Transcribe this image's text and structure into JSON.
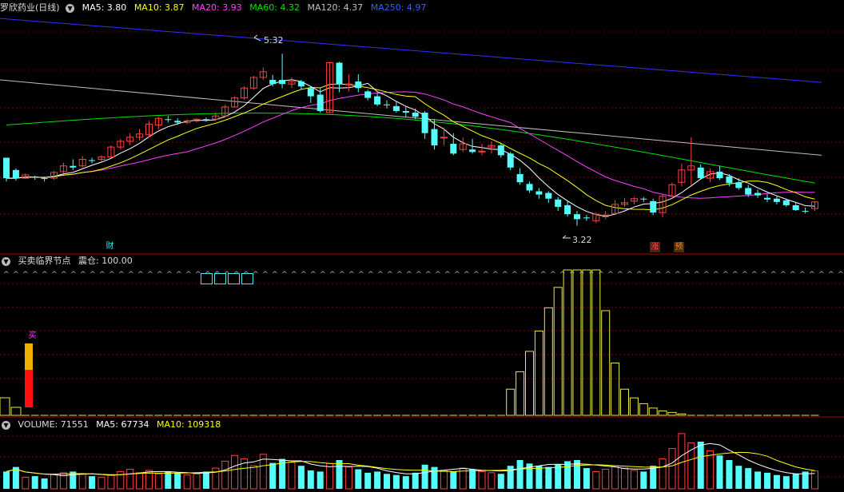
{
  "main_header": {
    "title": "罗欣药业(日线)",
    "ma5": "MA5: 3.80",
    "ma10": "MA10: 3.87",
    "ma20": "MA20: 3.93",
    "ma60": "MA60: 4.32",
    "ma120": "MA120: 4.37",
    "ma250": "MA250: 4.97"
  },
  "annotations": {
    "high": "5.32",
    "low": "3.22",
    "cai": "财",
    "zhang": "涨",
    "yu": "预"
  },
  "indicator_header": {
    "title": "买卖临界节点",
    "value": "震仓: 100.00",
    "buy_label": "买"
  },
  "volume_header": {
    "volume": "VOLUME: 71551",
    "ma5": "MA5: 67734",
    "ma10": "MA10: 109318"
  },
  "colors": {
    "up": "#ff4040",
    "down": "#54fcfc",
    "ma5": "#ffffff",
    "ma10": "#ffff00",
    "ma20": "#ff40ff",
    "ma60": "#00e000",
    "ma120": "#c0c0c0",
    "ma250": "#3030ff"
  },
  "chart_data": {
    "type": "candlestick",
    "candles": [
      [
        4.05,
        4.05,
        3.8,
        3.76
      ],
      [
        3.9,
        3.92,
        3.8,
        3.77
      ],
      [
        3.8,
        3.86,
        3.84,
        3.79
      ],
      [
        3.82,
        3.83,
        3.81,
        3.78
      ],
      [
        3.8,
        3.82,
        3.79,
        3.76
      ],
      [
        3.8,
        3.89,
        3.87,
        3.78
      ],
      [
        3.88,
        3.99,
        3.95,
        3.86
      ],
      [
        3.95,
        4.03,
        3.93,
        3.9
      ],
      [
        3.95,
        4.07,
        4.03,
        3.93
      ],
      [
        4.02,
        4.05,
        4.01,
        3.98
      ],
      [
        4.03,
        4.08,
        4.06,
        4.0
      ],
      [
        4.06,
        4.2,
        4.18,
        4.05
      ],
      [
        4.18,
        4.28,
        4.25,
        4.15
      ],
      [
        4.25,
        4.35,
        4.3,
        4.2
      ],
      [
        4.3,
        4.4,
        4.34,
        4.26
      ],
      [
        4.33,
        4.5,
        4.46,
        4.3
      ],
      [
        4.45,
        4.55,
        4.53,
        4.4
      ],
      [
        4.52,
        4.56,
        4.51,
        4.48
      ],
      [
        4.5,
        4.53,
        4.48,
        4.45
      ],
      [
        4.48,
        4.52,
        4.5,
        4.46
      ],
      [
        4.5,
        4.53,
        4.52,
        4.48
      ],
      [
        4.52,
        4.54,
        4.51,
        4.49
      ],
      [
        4.52,
        4.6,
        4.56,
        4.5
      ],
      [
        4.56,
        4.7,
        4.67,
        4.55
      ],
      [
        4.67,
        4.8,
        4.78,
        4.66
      ],
      [
        4.78,
        4.92,
        4.9,
        4.76
      ],
      [
        4.9,
        5.05,
        5.03,
        4.88
      ],
      [
        5.03,
        5.15,
        5.1,
        5.0
      ],
      [
        5.0,
        5.06,
        4.95,
        4.92
      ],
      [
        5.0,
        5.32,
        4.95,
        4.9
      ],
      [
        4.95,
        5.03,
        4.98,
        4.9
      ],
      [
        4.98,
        5.0,
        4.92,
        4.88
      ],
      [
        4.9,
        4.92,
        4.8,
        4.72
      ],
      [
        4.82,
        4.9,
        4.62,
        4.6
      ],
      [
        4.6,
        5.22,
        5.21,
        4.6
      ],
      [
        5.21,
        5.22,
        4.95,
        4.85
      ],
      [
        4.95,
        5.07,
        4.95,
        4.86
      ],
      [
        4.98,
        5.07,
        4.9,
        4.85
      ],
      [
        4.86,
        4.88,
        4.78,
        4.75
      ],
      [
        4.8,
        4.84,
        4.7,
        4.68
      ],
      [
        4.7,
        4.75,
        4.69,
        4.65
      ],
      [
        4.68,
        4.74,
        4.62,
        4.6
      ],
      [
        4.62,
        4.68,
        4.6,
        4.55
      ],
      [
        4.6,
        4.65,
        4.55,
        4.52
      ],
      [
        4.6,
        4.62,
        4.35,
        4.28
      ],
      [
        4.4,
        4.52,
        4.2,
        4.15
      ],
      [
        4.3,
        4.42,
        4.3,
        4.2
      ],
      [
        4.22,
        4.35,
        4.1,
        4.08
      ],
      [
        4.15,
        4.3,
        4.22,
        4.12
      ],
      [
        4.15,
        4.28,
        4.12,
        4.1
      ],
      [
        4.12,
        4.22,
        4.13,
        4.08
      ],
      [
        4.18,
        4.25,
        4.2,
        4.1
      ],
      [
        4.2,
        4.22,
        4.08,
        4.05
      ],
      [
        4.1,
        4.12,
        3.93,
        3.9
      ],
      [
        3.85,
        3.92,
        3.75,
        3.72
      ],
      [
        3.73,
        3.76,
        3.65,
        3.62
      ],
      [
        3.64,
        3.68,
        3.6,
        3.55
      ],
      [
        3.62,
        3.64,
        3.55,
        3.5
      ],
      [
        3.54,
        3.57,
        3.45,
        3.4
      ],
      [
        3.47,
        3.52,
        3.36,
        3.33
      ],
      [
        3.36,
        3.4,
        3.3,
        3.22
      ],
      [
        3.32,
        3.35,
        3.31,
        3.28
      ],
      [
        3.28,
        3.38,
        3.36,
        3.25
      ],
      [
        3.33,
        3.4,
        3.35,
        3.3
      ],
      [
        3.37,
        3.53,
        3.48,
        3.35
      ],
      [
        3.48,
        3.56,
        3.5,
        3.45
      ],
      [
        3.52,
        3.57,
        3.55,
        3.48
      ],
      [
        3.55,
        3.57,
        3.54,
        3.51
      ],
      [
        3.52,
        3.55,
        3.38,
        3.35
      ],
      [
        3.38,
        3.61,
        3.58,
        3.32
      ],
      [
        3.58,
        3.75,
        3.72,
        3.55
      ],
      [
        3.75,
        3.98,
        3.9,
        3.7
      ],
      [
        3.9,
        4.3,
        3.95,
        3.72
      ],
      [
        3.93,
        3.97,
        3.8,
        3.78
      ],
      [
        3.8,
        3.92,
        3.88,
        3.75
      ],
      [
        3.88,
        3.95,
        3.8,
        3.78
      ],
      [
        3.82,
        3.85,
        3.74,
        3.7
      ],
      [
        3.75,
        3.8,
        3.68,
        3.66
      ],
      [
        3.68,
        3.72,
        3.6,
        3.57
      ],
      [
        3.62,
        3.66,
        3.59,
        3.56
      ],
      [
        3.56,
        3.61,
        3.54,
        3.51
      ],
      [
        3.55,
        3.58,
        3.51,
        3.48
      ],
      [
        3.53,
        3.55,
        3.47,
        3.45
      ],
      [
        3.47,
        3.5,
        3.41,
        3.4
      ],
      [
        3.4,
        3.44,
        3.39,
        3.37
      ],
      [
        3.43,
        3.52,
        3.51,
        3.4
      ]
    ],
    "ma250_line": [
      5.75,
      4.97
    ],
    "ma120_line": [
      5.0,
      4.08
    ],
    "yrange": [
      3.05,
      5.8
    ],
    "volume": [
      30,
      38,
      20,
      22,
      18,
      25,
      28,
      30,
      26,
      22,
      20,
      24,
      30,
      34,
      28,
      32,
      26,
      30,
      28,
      24,
      26,
      30,
      36,
      48,
      58,
      52,
      40,
      60,
      45,
      52,
      46,
      40,
      32,
      30,
      44,
      50,
      38,
      34,
      28,
      30,
      26,
      24,
      22,
      28,
      42,
      38,
      32,
      30,
      36,
      34,
      30,
      28,
      26,
      40,
      50,
      44,
      40,
      38,
      42,
      48,
      50,
      36,
      30,
      34,
      40,
      36,
      32,
      30,
      40,
      52,
      70,
      96,
      80,
      82,
      66,
      58,
      50,
      40,
      36,
      30,
      28,
      24,
      22,
      26,
      30,
      31
    ],
    "vmax": 100,
    "indicator": [
      0,
      0,
      0,
      0,
      0,
      0,
      0,
      0,
      0,
      0,
      0,
      0,
      0,
      0,
      0,
      0,
      0,
      0,
      0,
      0,
      0,
      0,
      0,
      0,
      0,
      0,
      0,
      0,
      0,
      0,
      0,
      0,
      0,
      0,
      0,
      0,
      0,
      0,
      0,
      0,
      0,
      0,
      0,
      0,
      0,
      0,
      0,
      0,
      0,
      0,
      0,
      0,
      0,
      18,
      30,
      44,
      58,
      74,
      88,
      100,
      100,
      100,
      100,
      72,
      36,
      18,
      12,
      8,
      5,
      3,
      2,
      1,
      0,
      0,
      0,
      0,
      0,
      0,
      0,
      0,
      0,
      0,
      0,
      0,
      0,
      0
    ]
  }
}
